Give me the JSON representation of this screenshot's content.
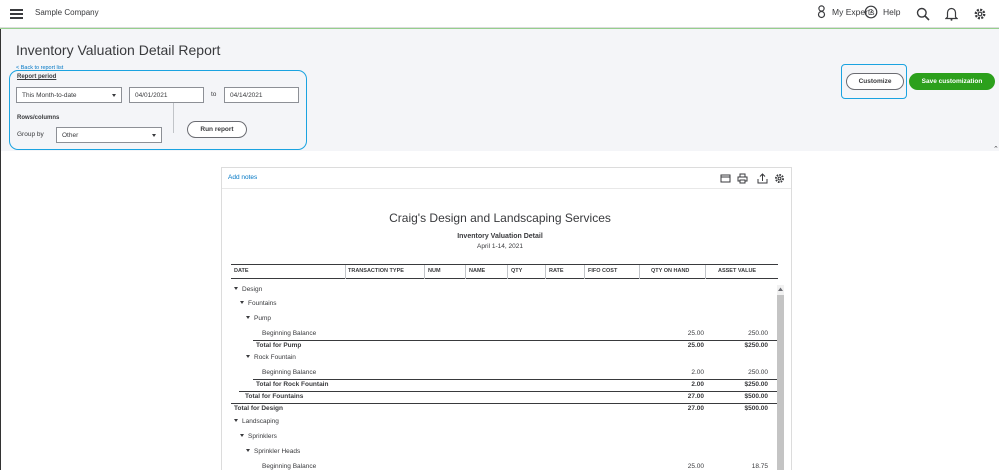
{
  "topbar": {
    "company_name": "Sample Company",
    "my_experts_label": "My Experts",
    "help_label": "Help"
  },
  "header": {
    "title": "Inventory Valuation Detail Report",
    "back_link": "< Back to report list",
    "report_period_label": "Report period",
    "period_select": "This Month-to-date",
    "date_from": "04/01/2021",
    "to_label": "to",
    "date_to": "04/14/2021",
    "rows_columns_label": "Rows/columns",
    "group_by_label": "Group by",
    "group_by_select": "Other",
    "run_report_label": "Run report",
    "customize_label": "Customize",
    "save_customization_label": "Save customization"
  },
  "report": {
    "add_notes_label": "Add notes",
    "company": "Craig's Design and Landscaping Services",
    "name": "Inventory Valuation Detail",
    "date_range": "April 1-14, 2021",
    "columns": [
      "DATE",
      "TRANSACTION TYPE",
      "NUM",
      "NAME",
      "QTY",
      "RATE",
      "FIFO COST",
      "QTY ON HAND",
      "ASSET VALUE"
    ],
    "rows": [
      {
        "label": "Design",
        "qty_on_hand": "",
        "asset_value": ""
      },
      {
        "label": "Fountains",
        "qty_on_hand": "",
        "asset_value": ""
      },
      {
        "label": "Pump",
        "qty_on_hand": "",
        "asset_value": ""
      },
      {
        "label": "Beginning Balance",
        "qty_on_hand": "25.00",
        "asset_value": "250.00"
      },
      {
        "label": "Total for Pump",
        "qty_on_hand": "25.00",
        "asset_value": "$250.00"
      },
      {
        "label": "Rock Fountain",
        "qty_on_hand": "",
        "asset_value": ""
      },
      {
        "label": "Beginning Balance",
        "qty_on_hand": "2.00",
        "asset_value": "250.00"
      },
      {
        "label": "Total for Rock Fountain",
        "qty_on_hand": "2.00",
        "asset_value": "$250.00"
      },
      {
        "label": "Total for Fountains",
        "qty_on_hand": "27.00",
        "asset_value": "$500.00"
      },
      {
        "label": "Total for Design",
        "qty_on_hand": "27.00",
        "asset_value": "$500.00"
      },
      {
        "label": "Landscaping",
        "qty_on_hand": "",
        "asset_value": ""
      },
      {
        "label": "Sprinklers",
        "qty_on_hand": "",
        "asset_value": ""
      },
      {
        "label": "Sprinkler Heads",
        "qty_on_hand": "",
        "asset_value": ""
      },
      {
        "label": "Beginning Balance",
        "qty_on_hand": "25.00",
        "asset_value": "18.75"
      }
    ]
  }
}
